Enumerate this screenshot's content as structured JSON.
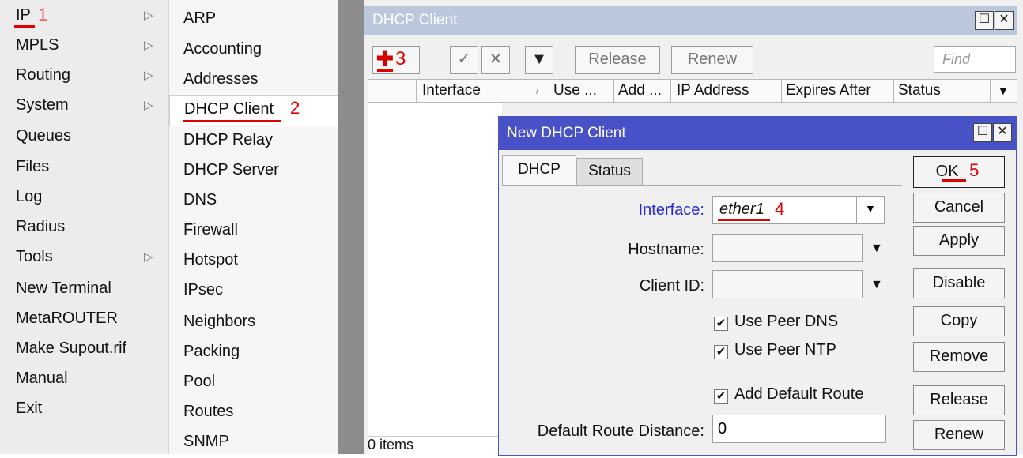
{
  "menu_primary": {
    "items": [
      {
        "label": "IP",
        "has_submenu": true,
        "marker": "1"
      },
      {
        "label": "MPLS",
        "has_submenu": true
      },
      {
        "label": "Routing",
        "has_submenu": true
      },
      {
        "label": "System",
        "has_submenu": true
      },
      {
        "label": "Queues",
        "has_submenu": false
      },
      {
        "label": "Files",
        "has_submenu": false
      },
      {
        "label": "Log",
        "has_submenu": false
      },
      {
        "label": "Radius",
        "has_submenu": false
      },
      {
        "label": "Tools",
        "has_submenu": true
      },
      {
        "label": "New Terminal",
        "has_submenu": false
      },
      {
        "label": "MetaROUTER",
        "has_submenu": false
      },
      {
        "label": "Make Supout.rif",
        "has_submenu": false
      },
      {
        "label": "Manual",
        "has_submenu": false
      },
      {
        "label": "Exit",
        "has_submenu": false
      }
    ],
    "submenu_arrow": "▷"
  },
  "menu_ip": {
    "items": [
      {
        "label": "ARP"
      },
      {
        "label": "Accounting"
      },
      {
        "label": "Addresses"
      },
      {
        "label": "DHCP Client",
        "selected": true,
        "marker": "2"
      },
      {
        "label": "DHCP Relay"
      },
      {
        "label": "DHCP Server"
      },
      {
        "label": "DNS"
      },
      {
        "label": "Firewall"
      },
      {
        "label": "Hotspot"
      },
      {
        "label": "IPsec"
      },
      {
        "label": "Neighbors"
      },
      {
        "label": "Packing"
      },
      {
        "label": "Pool"
      },
      {
        "label": "Routes"
      },
      {
        "label": "SNMP"
      }
    ]
  },
  "client_window": {
    "title": "DHCP Client",
    "toolbar": {
      "add_marker": "3",
      "release_label": "Release",
      "renew_label": "Renew",
      "find_placeholder": "Find"
    },
    "columns": [
      "Interface",
      "Use ...",
      "Add ...",
      "IP Address",
      "Expires After",
      "Status"
    ],
    "status_text": "0 items"
  },
  "dialog": {
    "title": "New DHCP Client",
    "tabs": [
      "DHCP",
      "Status"
    ],
    "fields": {
      "interface_label": "Interface:",
      "interface_value": "ether1",
      "interface_marker": "4",
      "hostname_label": "Hostname:",
      "client_id_label": "Client ID:",
      "use_peer_dns": "Use Peer DNS",
      "use_peer_ntp": "Use Peer NTP",
      "add_default_route": "Add Default Route",
      "distance_label": "Default Route Distance:",
      "distance_value": "0"
    },
    "checks": {
      "use_peer_dns": true,
      "use_peer_ntp": true,
      "add_default_route": true
    },
    "buttons": {
      "ok": "OK",
      "ok_marker": "5",
      "cancel": "Cancel",
      "apply": "Apply",
      "disable": "Disable",
      "copy": "Copy",
      "remove": "Remove",
      "release": "Release",
      "renew": "Renew"
    }
  },
  "colors": {
    "annotation_red": "#e00000",
    "dialog_title_bg": "#4951c7",
    "window_title_bg": "#bac8de",
    "interface_label_blue": "#2b2bd6"
  }
}
